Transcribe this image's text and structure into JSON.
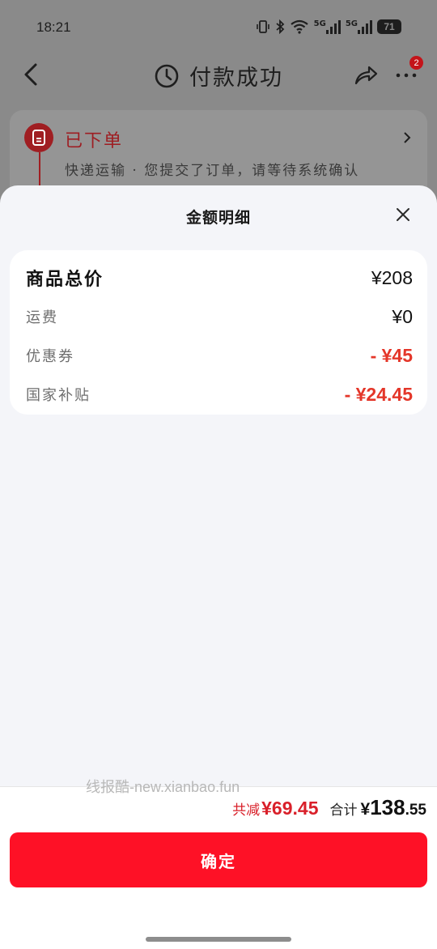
{
  "status_bar": {
    "time": "18:21",
    "signal1_label": "5G",
    "signal2_label": "5G",
    "battery": "71"
  },
  "nav": {
    "title": "付款成功",
    "badge_count": "2"
  },
  "order": {
    "status": "已下单",
    "description": "快递运输 · 您提交了订单，请等待系统确认"
  },
  "sheet": {
    "title": "金额明细",
    "rows": [
      {
        "label": "商品总价",
        "value": "¥208"
      },
      {
        "label": "运费",
        "value": "¥0"
      },
      {
        "label": "优惠券",
        "value": "- ¥45"
      },
      {
        "label": "国家补贴",
        "value": "- ¥24.45"
      }
    ]
  },
  "footer": {
    "watermark": "线报酷-new.xianbao.fun",
    "discount_label": "共减",
    "discount_value": "¥69.45",
    "total_label": "合计",
    "total_currency": "¥",
    "total_integer": "138",
    "total_decimal": ".55",
    "confirm_label": "确定"
  },
  "colors": {
    "accent_red": "#fe1126",
    "discount_red": "#e43629",
    "sheet_bg": "#f4f5f9"
  }
}
